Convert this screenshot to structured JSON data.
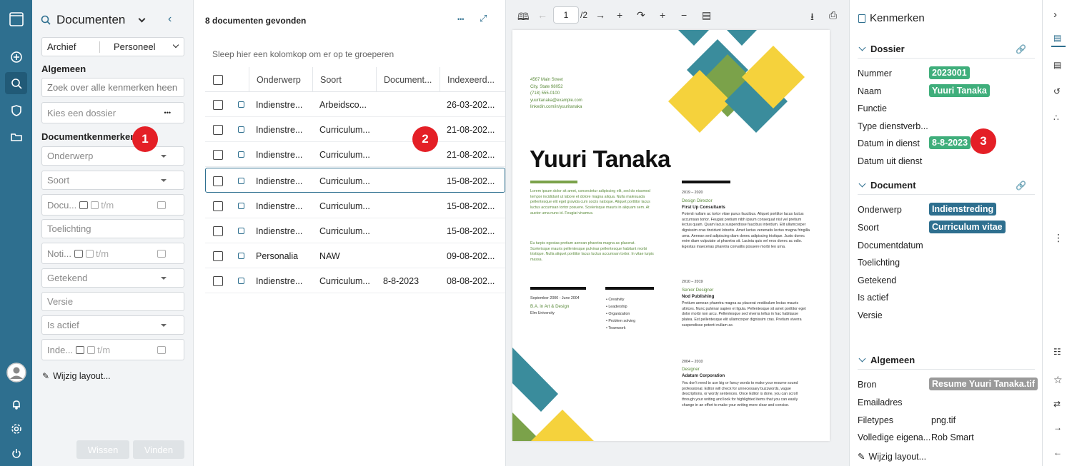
{
  "search": {
    "title": "Documenten",
    "archive_label": "Archief",
    "archive_value": "Personeel",
    "general_label": "Algemeen",
    "search_placeholder": "Zoek over alle kenmerken heen",
    "dossier_placeholder": "Kies een dossier",
    "dossier_more": "•••",
    "doc_props_label": "Documentkenmerken",
    "fields": {
      "onderwerp": "Onderwerp",
      "soort": "Soort",
      "documentdatum": "Docu...",
      "documentdatum_to": "t/m",
      "toelichting": "Toelichting",
      "notitie": "Noti...",
      "notitie_to": "t/m",
      "getekend": "Getekend",
      "versie": "Versie",
      "is_actief": "Is actief",
      "indexeer": "Inde...",
      "indexeer_to": "t/m"
    },
    "edit_layout": "Wijzig layout...",
    "clear_btn": "Wissen",
    "find_btn": "Vinden"
  },
  "badges": {
    "b1": "1",
    "b2": "2",
    "b3": "3"
  },
  "list": {
    "count_label": "8 documenten gevonden",
    "more": "•••",
    "group_hint": "Sleep hier een kolomkop om er op te groeperen",
    "columns": [
      "Onderwerp",
      "Soort",
      "Document...",
      "Indexeerd..."
    ],
    "rows": [
      {
        "onderwerp": "Indienstre...",
        "soort": "Arbeidsco...",
        "docdate": "",
        "indexdate": "26-03-202..."
      },
      {
        "onderwerp": "Indienstre...",
        "soort": "Curriculum...",
        "docdate": "",
        "indexdate": "21-08-202..."
      },
      {
        "onderwerp": "Indienstre...",
        "soort": "Curriculum...",
        "docdate": "",
        "indexdate": "21-08-202..."
      },
      {
        "onderwerp": "Indienstre...",
        "soort": "Curriculum...",
        "docdate": "",
        "indexdate": "15-08-202..."
      },
      {
        "onderwerp": "Indienstre...",
        "soort": "Curriculum...",
        "docdate": "",
        "indexdate": "15-08-202..."
      },
      {
        "onderwerp": "Indienstre...",
        "soort": "Curriculum...",
        "docdate": "",
        "indexdate": "15-08-202..."
      },
      {
        "onderwerp": "Personalia",
        "soort": "NAW",
        "docdate": "",
        "indexdate": "09-08-202..."
      },
      {
        "onderwerp": "Indienstre...",
        "soort": "Curriculum...",
        "docdate": "8-8-2023",
        "indexdate": "08-08-202..."
      }
    ]
  },
  "viewer": {
    "page_current": "1",
    "page_total": "/2",
    "cv": {
      "address": [
        "4567 Main Street",
        "City, State 98052",
        "(718) 555-0100",
        "yuuritanaka@example.com",
        "linkedin.com/in/yuuritanaka"
      ],
      "name": "Yuuri Tanaka",
      "intro1": "Lorem ipsum dolor sit amet, consectetur adipiscing elit, sed do eiusmod tempor incididunt ut labore et dolore magna aliqua. Nulla malesuada pellentesque elit eget gravida cum sociis natoque. Aliquet porttitor lacus luctus accumsan tortor posuere. Scelerisque mauris in aliquam sem. At auctor urna nunc id. Feugiat vivamus.",
      "intro2": "Eu turpis egestas pretium aenean pharetra magna ac placerat. Scelerisque mauris pellentesque pulvinar pellentesque habitant morbi tristique. Nulla aliquet porttitor lacus luctus accumsan tortor. In vitae turpis massa.",
      "edu_dates": "September 2000 - June 2004",
      "edu_degree": "B.A. in Art & Design",
      "edu_school": "Elm University",
      "skills": [
        "Creativity",
        "Leadership",
        "Organization",
        "Problem solving",
        "Teamwork"
      ],
      "jobs": [
        {
          "dates": "2019 – 2020",
          "title": "Design Director",
          "company": "First Up Consultants",
          "text": "Potenti nullam ac tortor vitae purus faucibus. Aliquet porttitor lacus luctus accumsan tortor. Feugiat pretium nibh ipsum consequat nisl vel pretium lectus quam. Quam lacus suspendisse faucibus interdum. Elit ullamcorper dignissim cras tincidunt lobortis. Amet luctus venenatis lectus magna fringilla urna. Aenean sed adipiscing diam donec adipiscing tristique. Justo donec enim diam vulputate ut pharetra sit. Lacinia quis vel eros donec ac odio. Egestas maecenas pharetra convallis posuere morbi leo urna."
        },
        {
          "dates": "2010 – 2019",
          "title": "Senior Designer",
          "company": "Nod Publishing",
          "text": "Pretium aenean pharetra magna ac placerat vestibulum lectus mauris ultrices. Nunc pulvinar sapien et ligula. Pellentesque sit amet porttitor eget dolor morbi non arcu. Pellentesque sed viverra tellus in hac habitasse platea. Est pellentesque elit ullamcorper dignissim cras. Pretium viverra suspendisse potenti nullam ac."
        },
        {
          "dates": "2004 – 2010",
          "title": "Designer",
          "company": "Adatum Corporation",
          "text": "You don't need to use big or fancy words to make your resume sound professional. Editor will check for unnecessary buzzwords, vague descriptions, or wordy sentences. Once Editor is done, you can scroll through your writing and look for highlighted items that you can easily change in an effort to make your writing more clear and concise."
        }
      ]
    }
  },
  "props": {
    "title": "Kenmerken",
    "dossier_label": "Dossier",
    "dossier_rows": [
      {
        "label": "Nummer",
        "value": "2023001",
        "tag": "green"
      },
      {
        "label": "Naam",
        "value": "Yuuri Tanaka",
        "tag": "green"
      },
      {
        "label": "Functie",
        "value": "",
        "tag": ""
      },
      {
        "label": "Type dienstverb...",
        "value": "",
        "tag": ""
      },
      {
        "label": "Datum in dienst",
        "value": "8-8-2023",
        "tag": "green"
      },
      {
        "label": "Datum uit dienst",
        "value": "",
        "tag": ""
      }
    ],
    "document_label": "Document",
    "document_rows": [
      {
        "label": "Onderwerp",
        "value": "Indienstreding",
        "tag": "blue"
      },
      {
        "label": "Soort",
        "value": "Curriculum vitae",
        "tag": "blue"
      },
      {
        "label": "Documentdatum",
        "value": "",
        "tag": ""
      },
      {
        "label": "Toelichting",
        "value": "",
        "tag": ""
      },
      {
        "label": "Getekend",
        "value": "",
        "tag": ""
      },
      {
        "label": "Is actief",
        "value": "",
        "tag": ""
      },
      {
        "label": "Versie",
        "value": "",
        "tag": ""
      }
    ],
    "general_label": "Algemeen",
    "general_rows": [
      {
        "label": "Bron",
        "value": "Resume Yuuri Tanaka.tif",
        "tag": "grey"
      },
      {
        "label": "Emailadres",
        "value": "",
        "tag": ""
      },
      {
        "label": "Filetypes",
        "value": "png.tif",
        "tag": ""
      },
      {
        "label": "Volledige eigena...",
        "value": "Rob Smart",
        "tag": ""
      }
    ],
    "edit_layout": "Wijzig layout..."
  },
  "colors": {
    "rail": "#2e6f8f",
    "accent_green": "#3fae7b",
    "badge_red": "#e41f26",
    "cv_teal": "#3a8c9c",
    "cv_yellow": "#f5d23c",
    "cv_green": "#7ba24a"
  }
}
